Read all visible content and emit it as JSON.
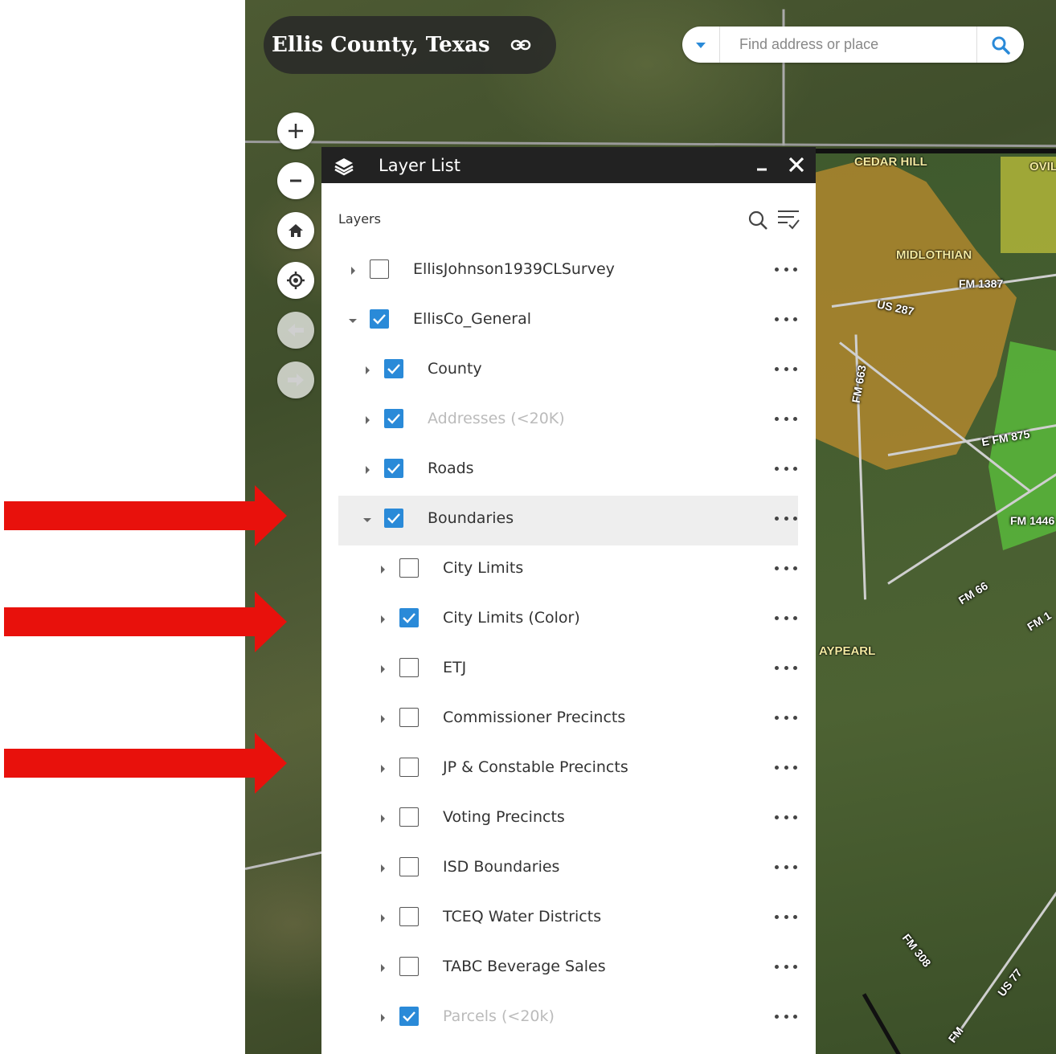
{
  "header": {
    "title": "Ellis County, Texas"
  },
  "search": {
    "placeholder": "Find address or place"
  },
  "map": {
    "labels": {
      "cedar_hill": "CEDAR HILL",
      "ovil": "OVIL",
      "midlothian": "MIDLOTHIAN",
      "fm1387": "FM 1387",
      "us287": "US 287",
      "fm663": "FM 663",
      "efm875": "E FM 875",
      "fm1446": "FM 1446",
      "fm66": "FM 66",
      "fm1": "FM 1",
      "aypearl": "AYPEARL",
      "fm308": "FM 308",
      "us77": "US 77",
      "fm": "FM"
    }
  },
  "layer_list": {
    "title": "Layer List",
    "section_label": "Layers",
    "items": [
      {
        "label": "EllisJohnson1939CLSurvey",
        "checked": false,
        "expanded": false,
        "level": 0,
        "dimmed": false
      },
      {
        "label": "EllisCo_General",
        "checked": true,
        "expanded": true,
        "level": 0,
        "dimmed": false
      },
      {
        "label": "County",
        "checked": true,
        "expanded": false,
        "level": 1,
        "dimmed": false
      },
      {
        "label": "Addresses (<20K)",
        "checked": true,
        "expanded": false,
        "level": 1,
        "dimmed": true
      },
      {
        "label": "Roads",
        "checked": true,
        "expanded": false,
        "level": 1,
        "dimmed": false
      },
      {
        "label": "Boundaries",
        "checked": true,
        "expanded": true,
        "level": 1,
        "dimmed": false,
        "highlighted": true
      },
      {
        "label": "City Limits",
        "checked": false,
        "expanded": false,
        "level": 2,
        "dimmed": false
      },
      {
        "label": "City Limits (Color)",
        "checked": true,
        "expanded": false,
        "level": 2,
        "dimmed": false
      },
      {
        "label": "ETJ",
        "checked": false,
        "expanded": false,
        "level": 2,
        "dimmed": false
      },
      {
        "label": "Commissioner Precincts",
        "checked": false,
        "expanded": false,
        "level": 2,
        "dimmed": false
      },
      {
        "label": "JP & Constable Precincts",
        "checked": false,
        "expanded": false,
        "level": 2,
        "dimmed": false
      },
      {
        "label": "Voting Precincts",
        "checked": false,
        "expanded": false,
        "level": 2,
        "dimmed": false
      },
      {
        "label": "ISD Boundaries",
        "checked": false,
        "expanded": false,
        "level": 2,
        "dimmed": false
      },
      {
        "label": "TCEQ Water Districts",
        "checked": false,
        "expanded": false,
        "level": 2,
        "dimmed": false
      },
      {
        "label": "TABC Beverage Sales",
        "checked": false,
        "expanded": false,
        "level": 2,
        "dimmed": false
      },
      {
        "label": "Parcels (<20k)",
        "checked": true,
        "expanded": false,
        "level": 2,
        "dimmed": true
      }
    ]
  },
  "colors": {
    "accent": "#2a8ad8",
    "panel_header": "#222222",
    "arrow": "#e8110c"
  },
  "icons": {
    "link": "link-icon",
    "search_dropdown": "caret-down-icon",
    "search": "search-icon",
    "zoom_in": "plus-icon",
    "zoom_out": "minus-icon",
    "home": "home-icon",
    "locate": "locate-icon",
    "back": "arrow-left-icon",
    "forward": "arrow-right-icon",
    "layers": "layers-icon",
    "minimize": "minimize-icon",
    "close": "close-icon",
    "filter": "filter-icon",
    "more": "more-icon"
  }
}
